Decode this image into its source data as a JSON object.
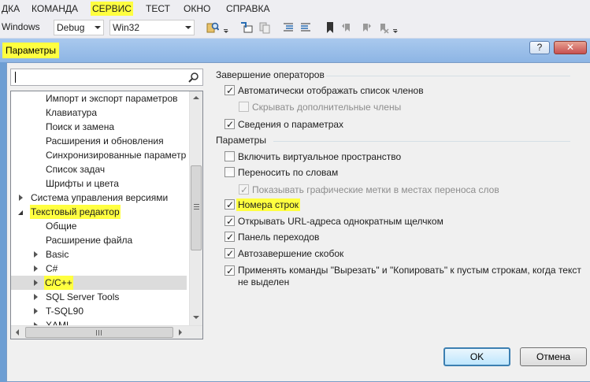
{
  "menubar": {
    "items": [
      "ДКА",
      "КОМАНДА",
      "СЕРВИС",
      "ТЕСТ",
      "ОКНО",
      "СПРАВКА"
    ]
  },
  "toolbar": {
    "platform_prefix": "Windows",
    "config_value": "Debug",
    "platform_value": "Win32"
  },
  "dialog": {
    "title": "Параметры",
    "help_label": "?",
    "close_label": "✕",
    "search_placeholder": "",
    "tree": [
      {
        "label": "Импорт и экспорт параметров"
      },
      {
        "label": "Клавиатура"
      },
      {
        "label": "Поиск и замена"
      },
      {
        "label": "Расширения и обновления"
      },
      {
        "label": "Синхронизированные параметр"
      },
      {
        "label": "Список задач"
      },
      {
        "label": "Шрифты и цвета"
      },
      {
        "label": "Система управления версиями"
      },
      {
        "label": "Текстовый редактор"
      },
      {
        "label": "Общие"
      },
      {
        "label": "Расширение файла"
      },
      {
        "label": "Basic"
      },
      {
        "label": "C#"
      },
      {
        "label": "C/C++"
      },
      {
        "label": "SQL Server Tools"
      },
      {
        "label": "T-SQL90"
      },
      {
        "label": "XAML"
      }
    ],
    "groups": {
      "completion": "Завершение операторов",
      "params": "Параметры"
    },
    "options": [
      {
        "label": "Автоматически отображать список членов",
        "checked": true
      },
      {
        "label": "Скрывать дополнительные члены",
        "checked": false
      },
      {
        "label": "Сведения о параметрах",
        "checked": true
      },
      {
        "label": "Включить виртуальное пространство",
        "checked": false
      },
      {
        "label": "Переносить по словам",
        "checked": false
      },
      {
        "label": "Показывать графические метки в местах переноса слов",
        "checked": true
      },
      {
        "label": "Номера строк",
        "checked": true
      },
      {
        "label": "Открывать URL-адреса однократным щелчком",
        "checked": true
      },
      {
        "label": "Панель переходов",
        "checked": true
      },
      {
        "label": "Автозавершение скобок",
        "checked": true
      },
      {
        "label": "Применять команды \"Вырезать\" и \"Копировать\" к пустым строкам, когда текст не выделен",
        "checked": true
      }
    ],
    "ok_label": "OK",
    "cancel_label": "Отмена"
  },
  "colors": {
    "highlight": "#ffff40",
    "dialog_frame": "#6d9ed3",
    "ok_border": "#3c7fb1"
  }
}
